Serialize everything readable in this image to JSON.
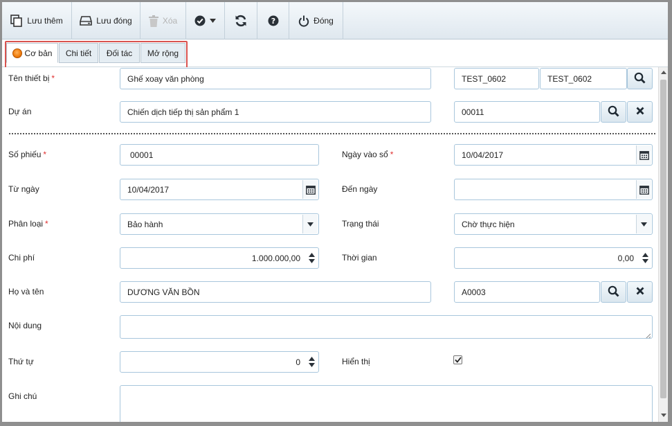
{
  "toolbar": {
    "save_more": "Lưu thêm",
    "save_close": "Lưu đóng",
    "delete": "Xóa",
    "close": "Đóng",
    "icons": [
      "copy-icon",
      "drive-icon",
      "trash-icon",
      "check-circle-icon",
      "refresh-icon",
      "help-icon",
      "power-icon"
    ]
  },
  "tabs": [
    {
      "label": "Cơ bản",
      "active": true
    },
    {
      "label": "Chi tiết",
      "active": false
    },
    {
      "label": "Đối tác",
      "active": false
    },
    {
      "label": "Mở rộng",
      "active": false
    }
  ],
  "form": {
    "device_name": {
      "label": "Tên thiết bị",
      "required": "*",
      "value": "Ghế xoay văn phòng",
      "code1": "TEST_0602",
      "code2": "TEST_0602"
    },
    "project": {
      "label": "Dự án",
      "value": "Chiến dịch tiếp thị sản phẩm 1",
      "code": "00011"
    },
    "ticket_no": {
      "label": "Số phiếu",
      "required": "*",
      "value": "00001"
    },
    "entry_date": {
      "label": "Ngày vào sổ",
      "required": "*",
      "value": "10/04/2017"
    },
    "from_date": {
      "label": "Từ ngày",
      "value": "10/04/2017"
    },
    "to_date": {
      "label": "Đến ngày",
      "value": ""
    },
    "category": {
      "label": "Phân loại",
      "required": "*",
      "value": "Bảo hành"
    },
    "status": {
      "label": "Trạng thái",
      "value": "Chờ thực hiện"
    },
    "cost": {
      "label": "Chi phí",
      "value": "1.000.000,00"
    },
    "time": {
      "label": "Thời gian",
      "value": "0,00"
    },
    "full_name": {
      "label": "Họ và tên",
      "value": "DƯƠNG VĂN BỒN",
      "code": "A0003"
    },
    "content": {
      "label": "Nội dung",
      "value": ""
    },
    "order": {
      "label": "Thứ tự",
      "value": "0"
    },
    "display": {
      "label": "Hiển thị",
      "checked": true
    },
    "note": {
      "label": "Ghi chú",
      "value": ""
    }
  },
  "colors": {
    "accent": "#2b6e9e",
    "required": "#e03030",
    "tab_highlight": "#d9534f",
    "orange": "#f07f10"
  }
}
